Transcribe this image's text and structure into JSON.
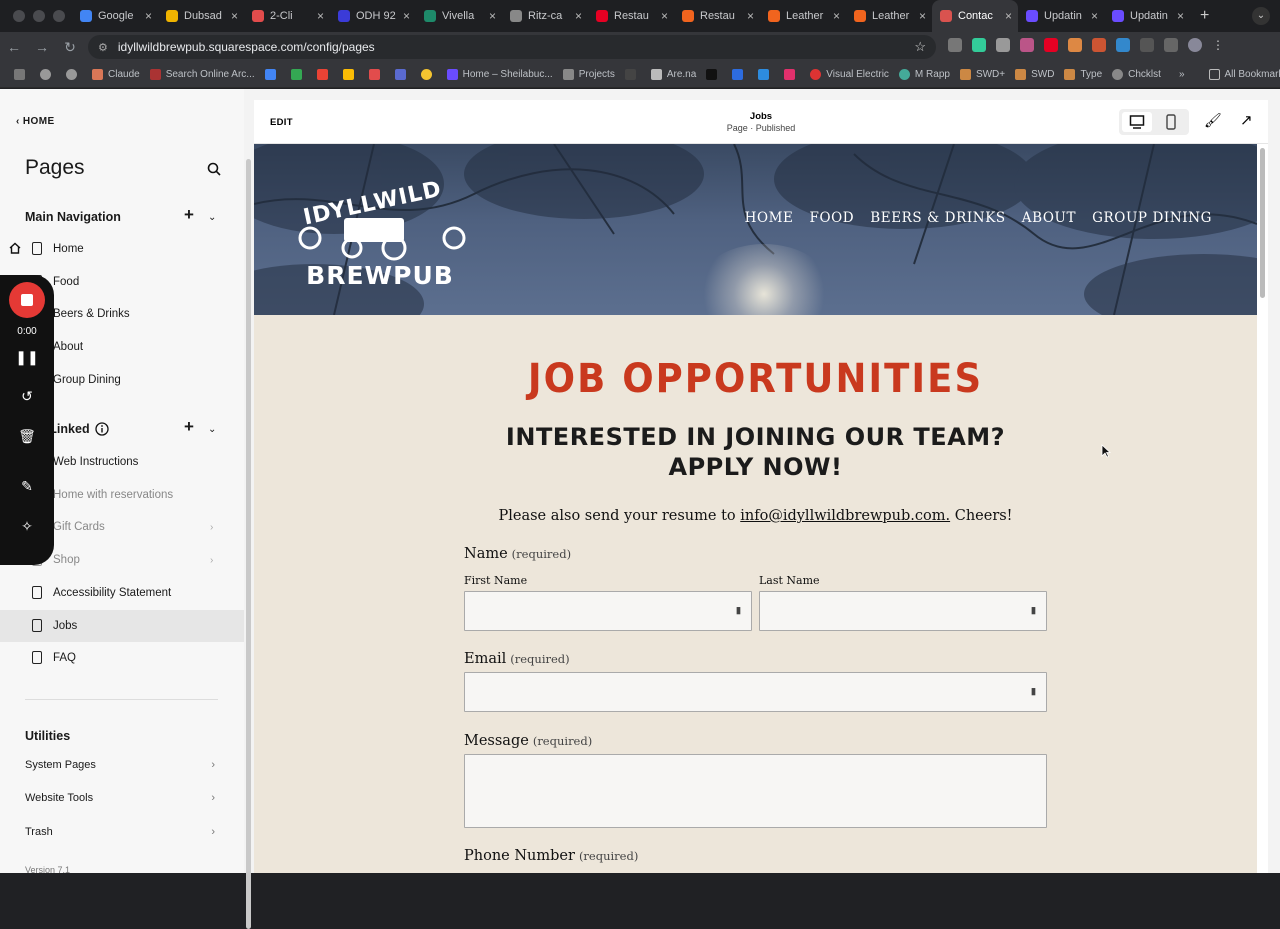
{
  "browser": {
    "tabs": [
      {
        "title": "Google",
        "color": "#4285f4"
      },
      {
        "title": "Dubsad",
        "color": "#f0b400"
      },
      {
        "title": "2-Cli",
        "color": "#e24c4c"
      },
      {
        "title": "ODH 92",
        "color": "#3b3bd8"
      },
      {
        "title": "Vivella",
        "color": "#1e8a6a"
      },
      {
        "title": "Ritz-ca",
        "color": "#888888"
      },
      {
        "title": "Restau",
        "color": "#e60023"
      },
      {
        "title": "Restau",
        "color": "#f1641e"
      },
      {
        "title": "Leather",
        "color": "#f1641e"
      },
      {
        "title": "Leather",
        "color": "#f1641e"
      },
      {
        "title": "Contac",
        "color": "#d9534f",
        "active": true
      },
      {
        "title": "Updatin",
        "color": "#6a4cff"
      },
      {
        "title": "Updatin",
        "color": "#6a4cff"
      }
    ],
    "url": "idyllwildbrewpub.squarespace.com/config/pages",
    "bookmarks": [
      "Claude",
      "Search Online Arc...",
      "Home – Sheilabuc...",
      "Projects",
      "Are.na",
      "Visual Electric",
      "M Rapp",
      "SWD+",
      "SWD",
      "Type",
      "Chcklst"
    ],
    "all_bookmarks": "All Bookmarks"
  },
  "sidebar": {
    "home_link": "HOME",
    "title": "Pages",
    "main_nav_label": "Main Navigation",
    "main_nav": [
      "Home",
      "Food",
      "Beers & Drinks",
      "About",
      "Group Dining"
    ],
    "not_linked_label": "Not Linked",
    "not_linked": [
      {
        "label": "Web Instructions",
        "dim": false
      },
      {
        "label": "Home with reservations",
        "dim": true
      },
      {
        "label": "Gift Cards",
        "dim": true
      },
      {
        "label": "Shop",
        "dim": true
      },
      {
        "label": "Accessibility Statement",
        "dim": false
      },
      {
        "label": "Jobs",
        "dim": false,
        "selected": true
      },
      {
        "label": "FAQ",
        "dim": false
      }
    ],
    "utilities_label": "Utilities",
    "utilities": [
      "System Pages",
      "Website Tools",
      "Trash"
    ],
    "version": "Version 7.1"
  },
  "recorder": {
    "time": "0:00"
  },
  "editor": {
    "edit_label": "EDIT",
    "page_title": "Jobs",
    "page_status": "Page · Published"
  },
  "site": {
    "logo_top": "IDYLLWILD",
    "logo_bottom": "BREWPUB",
    "nav": [
      "HOME",
      "FOOD",
      "BEERS & DRINKS",
      "ABOUT",
      "GROUP DINING"
    ],
    "heading": "JOB OPPORTUNITIES",
    "subheading_line1": "INTERESTED IN JOINING OUR TEAM?",
    "subheading_line2": "APPLY NOW!",
    "note_before": "Please also send your resume to ",
    "note_email": "info@idyllwildbrewpub.com.",
    "note_after": " Cheers!",
    "form": {
      "name_label": "Name",
      "required": "(required)",
      "first_name": "First Name",
      "last_name": "Last Name",
      "email_label": "Email",
      "message_label": "Message",
      "phone_label": "Phone Number"
    },
    "colors": {
      "heading": "#c9391e",
      "background": "#ede6da"
    }
  }
}
